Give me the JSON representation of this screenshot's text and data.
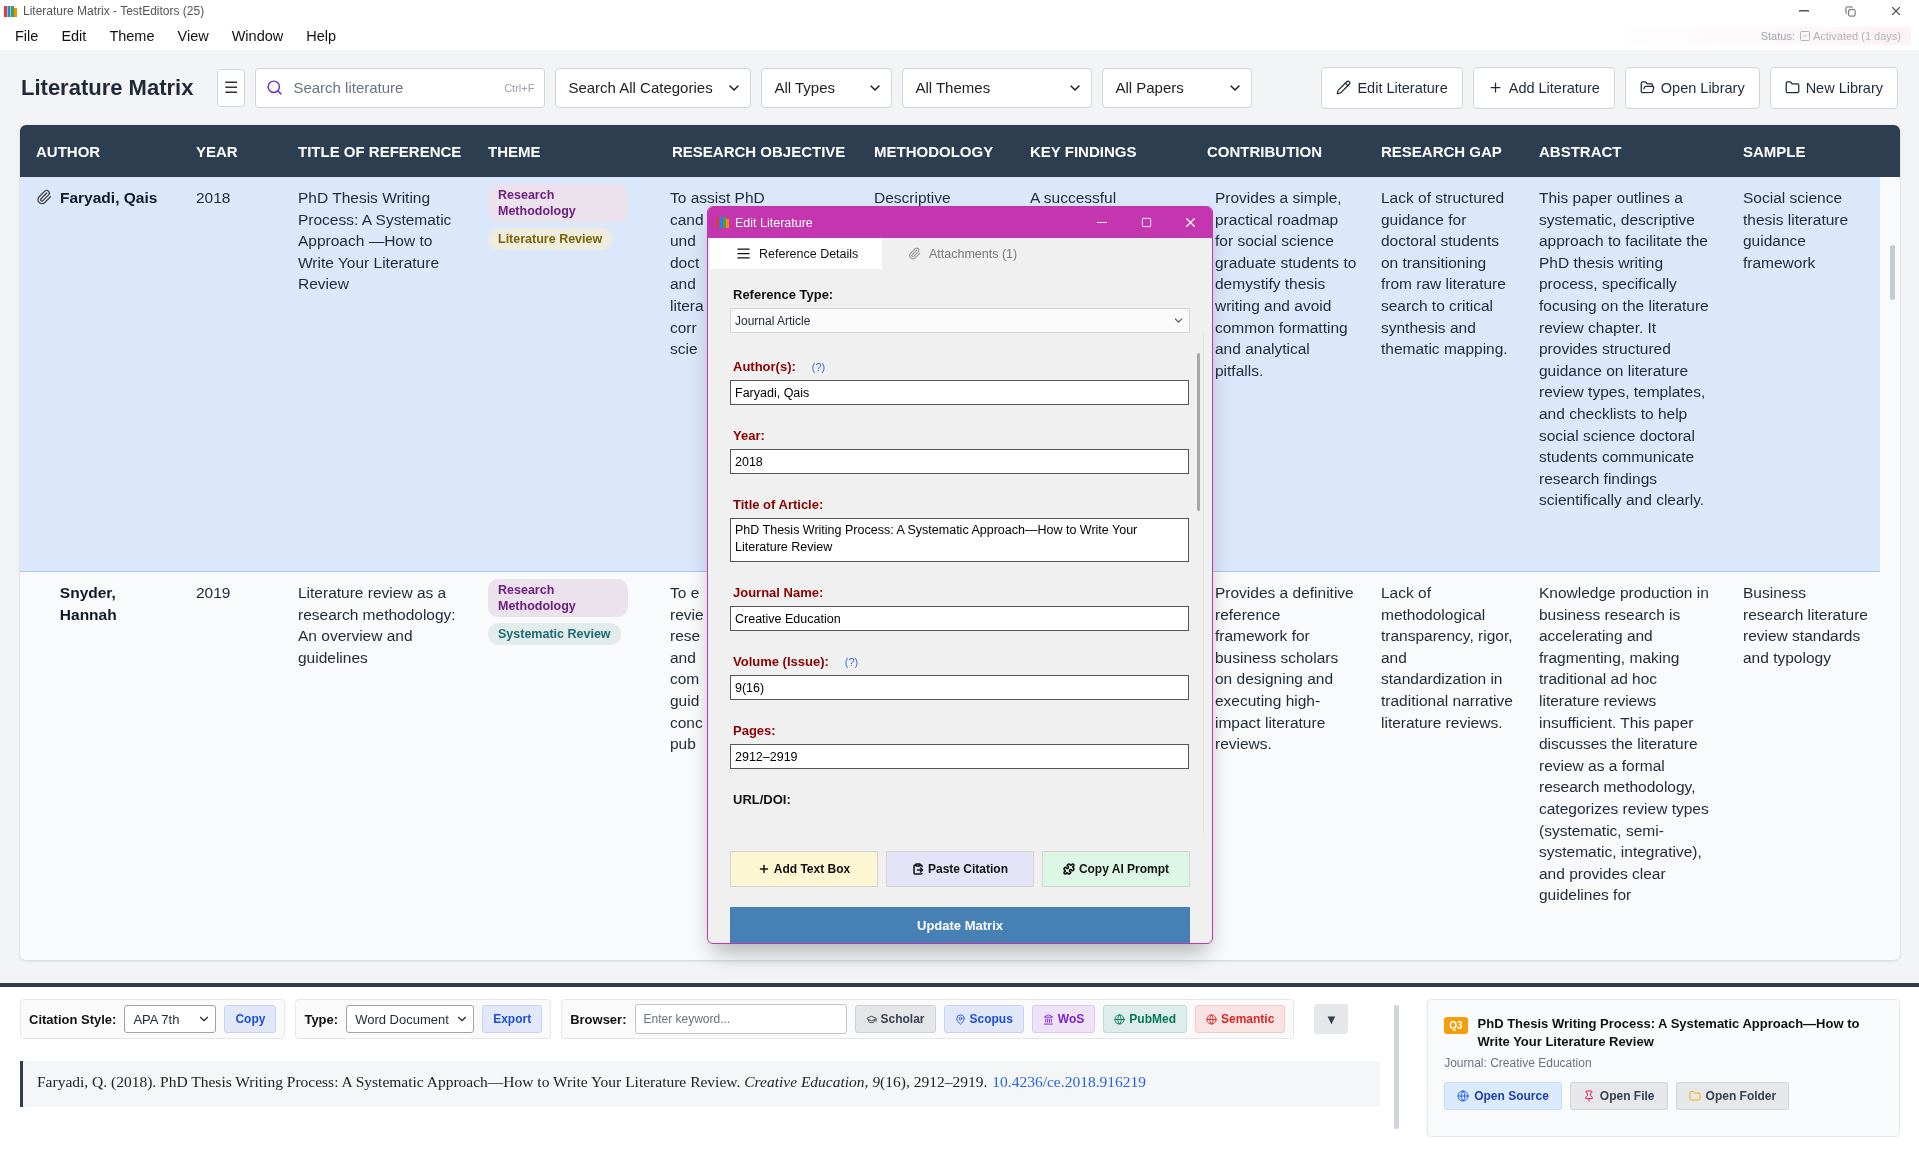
{
  "window": {
    "title": "Literature Matrix - TestEditors (25)"
  },
  "menu": [
    "File",
    "Edit",
    "Theme",
    "View",
    "Window",
    "Help"
  ],
  "status": {
    "label": "Status:",
    "value": "Activated (1 days)",
    "activated": true
  },
  "header": {
    "title": "Literature Matrix",
    "menu_glyph": "☰",
    "search": {
      "placeholder": "Search literature",
      "shortcut": "Ctrl+F"
    },
    "filters": [
      "Search All Categories",
      "All Types",
      "All Themes",
      "All Papers"
    ],
    "buttons": [
      "Edit Literature",
      "Add Literature",
      "Open Library",
      "New Library"
    ]
  },
  "table": {
    "columns": [
      "AUTHOR",
      "YEAR",
      "TITLE OF REFERENCE",
      "THEME",
      "RESEARCH OBJECTIVE",
      "METHODOLOGY",
      "KEY FINDINGS",
      "CONTRIBUTION",
      "RESEARCH GAP",
      "ABSTRACT",
      "SAMPLE"
    ],
    "rows": [
      {
        "selected": true,
        "attachment": true,
        "author": "Faryadi, Qais",
        "year": "2018",
        "title": "PhD Thesis Writing Process: A Systematic Approach —How to Write Your Literature Review",
        "themes": [
          {
            "label": "Research Methodology",
            "color": "#6b217f"
          },
          {
            "label": "Literature Review",
            "color": "#7a6508"
          }
        ],
        "research_objective": "To assist PhD\ncand\nund\ndoct\nand\nlitera\ncorr\nscie",
        "methodology": "Descriptive",
        "key_findings": "A successful",
        "contribution": "Provides a simple, practical roadmap for social science graduate students to demystify thesis writing and avoid common formatting and analytical pitfalls.",
        "research_gap": "Lack of structured guidance for doctoral students on transitioning from raw literature search to critical synthesis and thematic mapping.",
        "abstract": "This paper outlines a systematic, descriptive approach to facilitate the PhD thesis writing process, specifically focusing on the literature review chapter. It provides structured guidance on literature review types, templates, and checklists to help social science doctoral students communicate research findings scientifically and clearly.",
        "sample": "Social science thesis literature guidance framework"
      },
      {
        "selected": false,
        "attachment": false,
        "author": "Snyder, Hannah",
        "year": "2019",
        "title": "Literature review as a research methodology: An overview and guidelines",
        "themes": [
          {
            "label": "Research Methodology",
            "color": "#6b217f"
          },
          {
            "label": "Systematic Review",
            "color": "#1e6b73"
          }
        ],
        "research_objective": "To e\nrevie\nrese\nand\ncom\nguid\nconc\npub",
        "contribution": "Provides a definitive reference framework for business scholars on designing and executing high-impact literature reviews.",
        "research_gap": "Lack of methodological transparency, rigor, and standardization in traditional narrative literature reviews.",
        "abstract": "Knowledge production in business research is accelerating and fragmenting, making traditional ad hoc literature reviews insufficient. This paper discusses the literature review as a formal research methodology, categorizes review types (systematic, semi-systematic, integrative), and provides clear guidelines for",
        "sample": "Business research literature review standards and typology"
      }
    ]
  },
  "dialog": {
    "title": "Edit Literature",
    "tabs": [
      {
        "label": "Reference Details",
        "selected": true
      },
      {
        "label": "Attachments (1)",
        "selected": false
      }
    ],
    "reference_type": {
      "label": "Reference Type:",
      "value": "Journal Article"
    },
    "fields": [
      {
        "label": "Author(s):",
        "required": true,
        "help": "(?)",
        "kind": "input",
        "value": "Faryadi, Qais"
      },
      {
        "label": "Year:",
        "required": true,
        "kind": "input",
        "value": "2018"
      },
      {
        "label": "Title of Article:",
        "required": true,
        "kind": "textarea",
        "value": "PhD Thesis Writing Process: A Systematic Approach—How to Write Your Literature Review"
      },
      {
        "label": "Journal Name:",
        "required": true,
        "kind": "input",
        "value": "Creative Education"
      },
      {
        "label": "Volume (Issue):",
        "required": true,
        "help": "(?)",
        "kind": "input",
        "value": "9(16)"
      },
      {
        "label": "Pages:",
        "required": true,
        "kind": "input",
        "value": "2912–2919"
      },
      {
        "label": "URL/DOI:",
        "required": false,
        "kind": "label"
      }
    ],
    "actions": [
      {
        "label": "Add Text Box",
        "color": "#fdf6d3"
      },
      {
        "label": "Paste Citation",
        "color": "#e4e4f8"
      },
      {
        "label": "Copy AI Prompt",
        "color": "#dcf7e6"
      }
    ],
    "submit": "Update Matrix"
  },
  "bottom": {
    "citation_style": {
      "label": "Citation Style:",
      "value": "APA 7th",
      "button": "Copy"
    },
    "type": {
      "label": "Type:",
      "value": "Word Document",
      "button": "Export"
    },
    "browser": {
      "label": "Browser:",
      "placeholder": "Enter keyword...",
      "sources": [
        {
          "label": "Scholar",
          "color": "#374151"
        },
        {
          "label": "Scopus",
          "color": "#1d4ed8"
        },
        {
          "label": "WoS",
          "color": "#7e22ce"
        },
        {
          "label": "PubMed",
          "color": "#047857"
        },
        {
          "label": "Semantic",
          "color": "#dc2626"
        }
      ]
    },
    "collapse": "▼",
    "citation": {
      "text": "Faryadi, Q. (2018). PhD Thesis Writing Process: A Systematic Approach—How to Write Your Literature Review. *Creative Education*, *9*(16), 2912–2919.",
      "doi": "10.4236/ce.2018.916219"
    },
    "card": {
      "badge": "Q3",
      "title": "PhD Thesis Writing Process: A Systematic Approach—How to Write Your Literature Review",
      "journal": "Journal: Creative Education",
      "buttons": [
        "Open Source",
        "Open File",
        "Open Folder"
      ]
    }
  }
}
